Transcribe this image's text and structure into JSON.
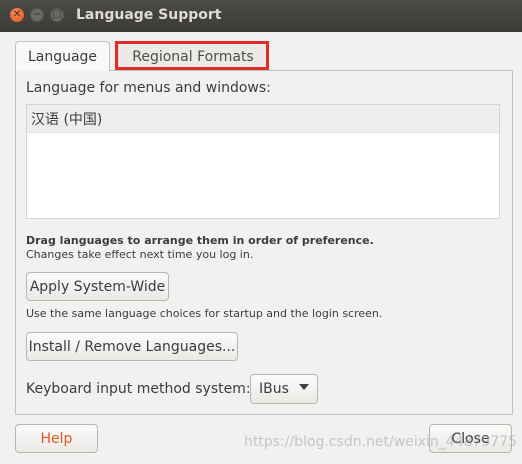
{
  "window": {
    "title": "Language Support",
    "controls": {
      "close": "✕",
      "minimize": "−",
      "maximize": "□"
    }
  },
  "tabs": [
    {
      "label": "Language",
      "active": true
    },
    {
      "label": "Regional Formats",
      "active": false
    }
  ],
  "highlight_color": "#e12c2c",
  "language_tab": {
    "heading": "Language for menus and windows:",
    "languages": [
      "汉语 (中国)"
    ],
    "drag_hint": "Drag languages to arrange them in order of preference.",
    "changes_note": "Changes take effect next time you log in.",
    "apply_button": "Apply System-Wide",
    "apply_description": "Use the same language choices for startup and the login screen.",
    "install_button": "Install / Remove Languages...",
    "keyboard_label": "Keyboard input method system:",
    "keyboard_value": "IBus"
  },
  "footer": {
    "help_button": "Help",
    "close_button": "Close"
  },
  "watermark": "https://blog.csdn.net/weixin_44879775"
}
